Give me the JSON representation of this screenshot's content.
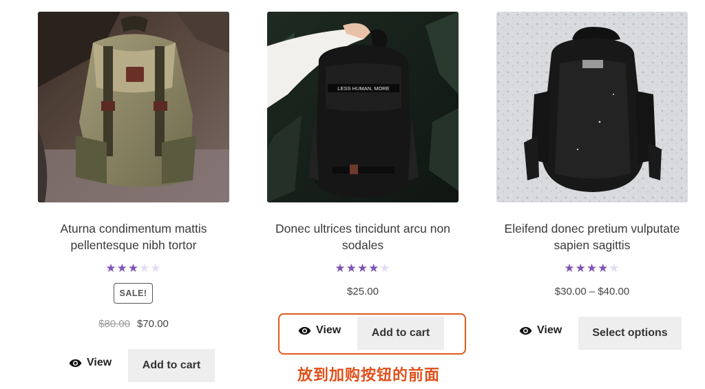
{
  "products": [
    {
      "title": "Aturna condimentum mattis pellentesque nibh tortor",
      "rating_stars": [
        "★",
        "★",
        "★",
        "★",
        "★"
      ],
      "rating": 3,
      "sale_badge": "SALE!",
      "price_old": "$80.00",
      "price": "$70.00",
      "view_label": "View",
      "button_label": "Add to cart"
    },
    {
      "title": "Donec ultrices tincidunt arcu non sodales",
      "rating_stars": [
        "★",
        "★",
        "★",
        "★",
        "★"
      ],
      "rating": 4,
      "price": "$25.00",
      "view_label": "View",
      "button_label": "Add to cart",
      "image_strap_text": "LESS HUMAN, MORE"
    },
    {
      "title": "Eleifend donec pretium vulputate sapien sagittis",
      "rating_stars": [
        "★",
        "★",
        "★",
        "★",
        "★"
      ],
      "rating": 4,
      "price": "$30.00 – $40.00",
      "view_label": "View",
      "button_label": "Select options"
    }
  ],
  "annotation": {
    "text": "放到加购按钮的前面",
    "color": "#e0501a"
  },
  "colors": {
    "star_on": "#7f54b3",
    "star_off": "#e3dcf0",
    "button_bg": "#eeeeee"
  },
  "icons": {
    "view": "eye-icon"
  }
}
